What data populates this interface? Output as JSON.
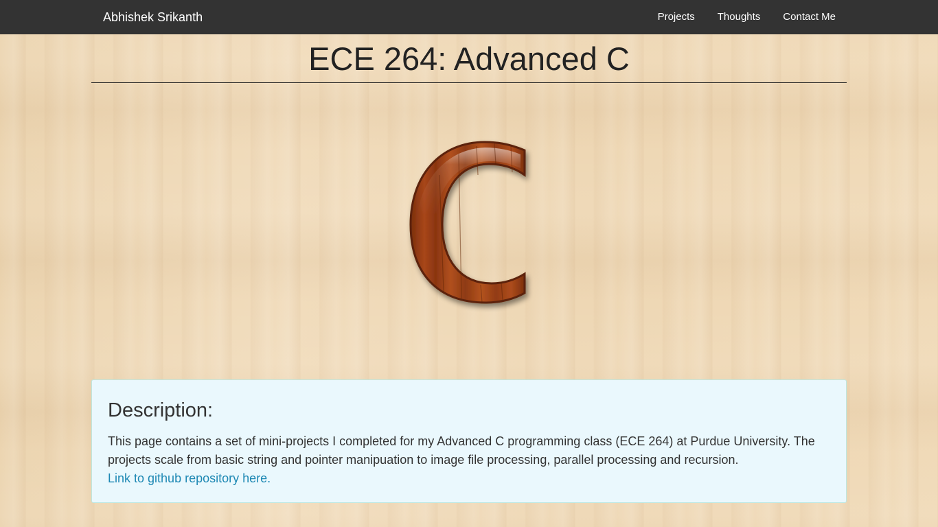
{
  "navbar": {
    "brand": "Abhishek Srikanth",
    "links": [
      {
        "label": "Projects"
      },
      {
        "label": "Thoughts"
      },
      {
        "label": "Contact Me"
      }
    ],
    "background_color": "#333333"
  },
  "page": {
    "title": "ECE 264: Advanced C",
    "logo_icon": "wooden-letter-c-icon"
  },
  "description": {
    "heading": "Description:",
    "text": "This page contains a set of mini-projects I completed for my Advanced C programming class (ECE 264) at Purdue University. The projects scale from basic string and pointer manipuation to image file processing, parallel processing and recursion.",
    "link_label": "Link to github repository here.",
    "panel_color": "#eaf8fd",
    "link_color": "#1d88b4"
  }
}
